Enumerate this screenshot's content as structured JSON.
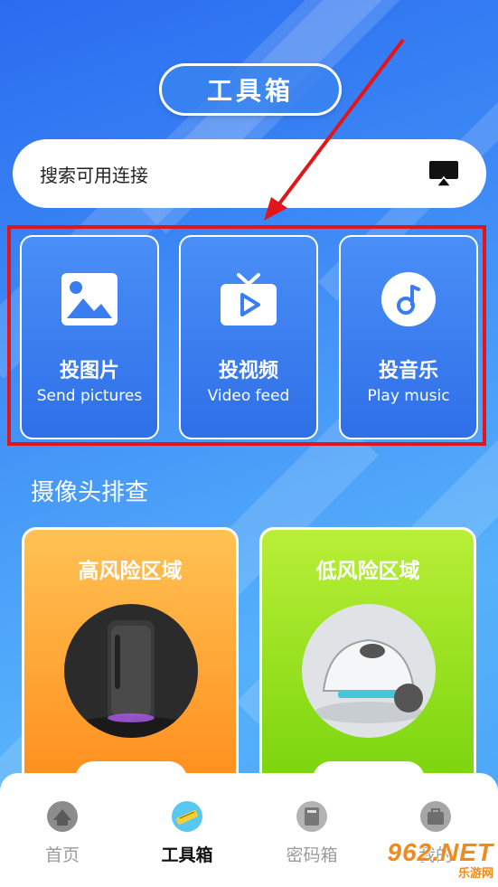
{
  "header": {
    "title": "工具箱"
  },
  "search": {
    "label": "搜索可用连接",
    "icon": "screen-cast-icon"
  },
  "cast_features": [
    {
      "cn": "投图片",
      "en": "Send pictures",
      "icon": "image-icon"
    },
    {
      "cn": "投视频",
      "en": "Video feed",
      "icon": "tv-play-icon"
    },
    {
      "cn": "投音乐",
      "en": "Play music",
      "icon": "music-note-icon"
    }
  ],
  "camera_check": {
    "title": "摄像头排查",
    "zones": [
      {
        "title": "高风险区域",
        "color": "#ff9b2a"
      },
      {
        "title": "低风险区域",
        "color": "#8bdc16"
      }
    ]
  },
  "tabbar": {
    "tabs": [
      {
        "label": "首页",
        "icon": "home-icon"
      },
      {
        "label": "工具箱",
        "icon": "toolbox-icon",
        "active": true
      },
      {
        "label": "密码箱",
        "icon": "password-book-icon"
      },
      {
        "label": "我的",
        "icon": "profile-bag-icon"
      }
    ]
  },
  "watermark": {
    "big": "962.NET",
    "small": "乐游网"
  }
}
